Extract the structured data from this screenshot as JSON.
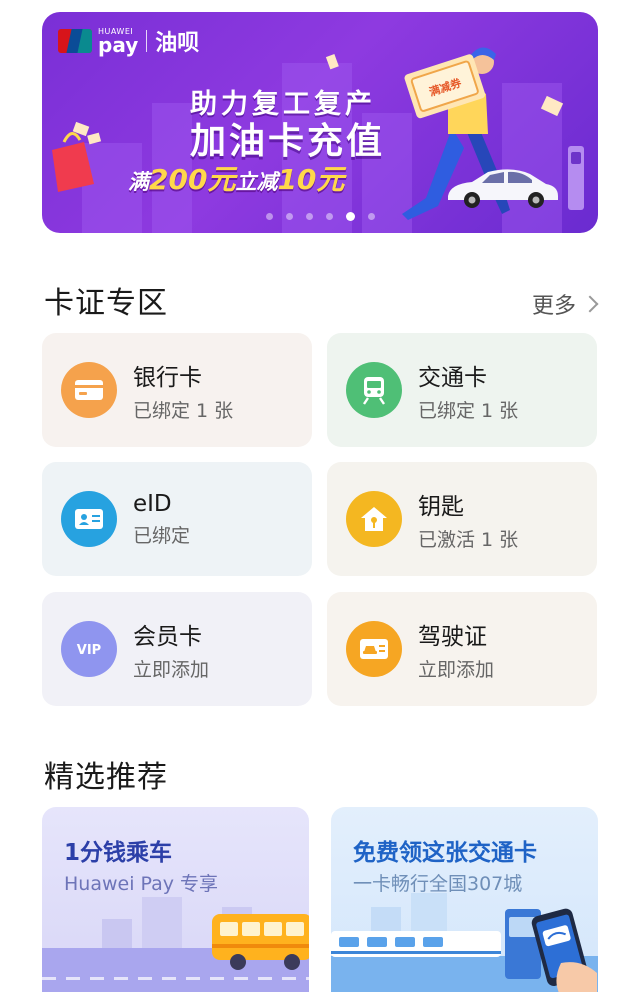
{
  "banner": {
    "wallet_brand": "HUAWEI",
    "pay_label": "pay",
    "partner_name": "油呗",
    "headline_1": "助力复工复产",
    "headline_2": "加油卡充值",
    "offer_prefix": "满",
    "offer_amount_1": "200元",
    "offer_mid": "立减",
    "offer_amount_2": "10元",
    "coupon_label": "满减券",
    "page_count": 6,
    "active_page": 5
  },
  "cards_section": {
    "title": "卡证专区",
    "more_label": "更多"
  },
  "cards": [
    {
      "name": "银行卡",
      "status": "已绑定 1 张",
      "icon": "bank-card-icon",
      "bg": "#f7f2ef",
      "icon_color": "#f5a24c"
    },
    {
      "name": "交通卡",
      "status": "已绑定 1 张",
      "icon": "train-icon",
      "bg": "#eef4ef",
      "icon_color": "#4fbf76"
    },
    {
      "name": "eID",
      "status": "已绑定",
      "icon": "id-card-icon",
      "bg": "#eef3f6",
      "icon_color": "#27a2e0"
    },
    {
      "name": "钥匙",
      "status": "已激活 1 张",
      "icon": "home-key-icon",
      "bg": "#f5f3ee",
      "icon_color": "#f4b721"
    },
    {
      "name": "会员卡",
      "status": "立即添加",
      "icon": "vip-icon",
      "bg": "#f1f1f7",
      "icon_color": "#8f95ef",
      "icon_text": "VIP"
    },
    {
      "name": "驾驶证",
      "status": "立即添加",
      "icon": "driver-license-icon",
      "bg": "#f7f3ee",
      "icon_color": "#f6a623"
    }
  ],
  "recommend_section": {
    "title": "精选推荐"
  },
  "promos": [
    {
      "title": "1分钱乘车",
      "subtitle": "Huawei Pay 专享"
    },
    {
      "title": "免费领这张交通卡",
      "subtitle": "一卡畅行全国307城"
    }
  ]
}
